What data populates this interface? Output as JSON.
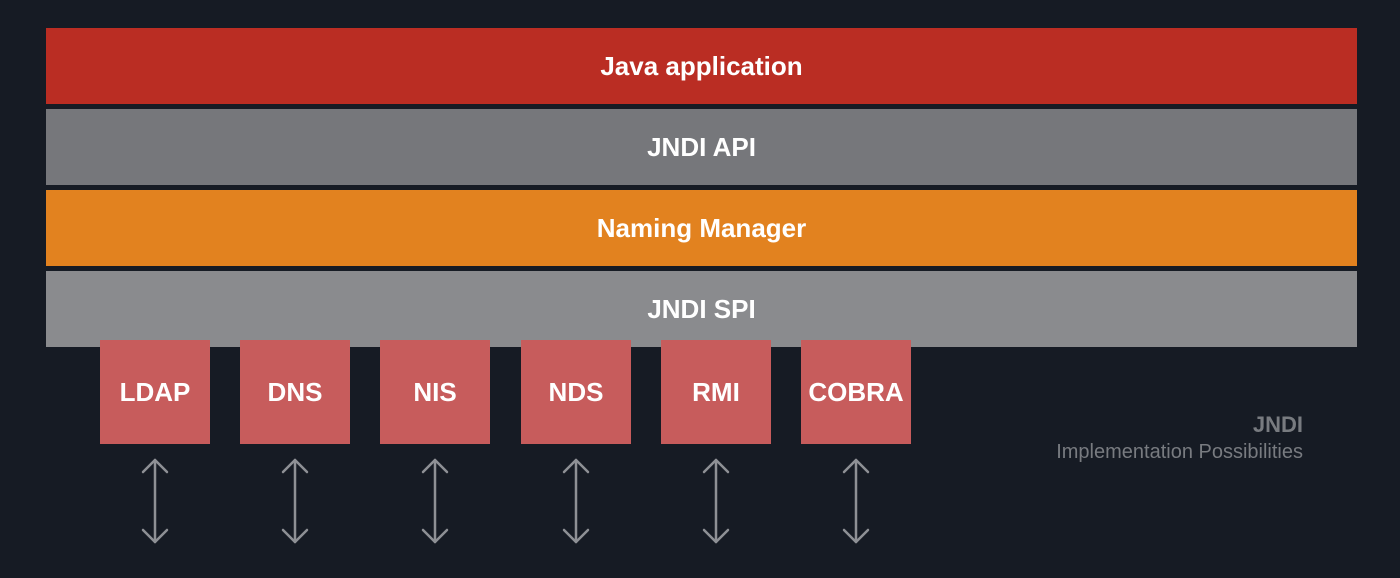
{
  "layers": [
    {
      "label": "Java application",
      "color": "#ba2d23"
    },
    {
      "label": "JNDI API",
      "color": "#76777b"
    },
    {
      "label": "Naming Manager",
      "color": "#e2821f"
    },
    {
      "label": "JNDI SPI",
      "color": "#8a8b8e"
    }
  ],
  "providers": {
    "color": "#c75c5c",
    "items": [
      {
        "label": "LDAP"
      },
      {
        "label": "DNS"
      },
      {
        "label": "NIS"
      },
      {
        "label": "NDS"
      },
      {
        "label": "RMI"
      },
      {
        "label": "COBRA"
      }
    ]
  },
  "arrow_icon": "double-arrow-vertical-icon",
  "arrow_color": "#8e9095",
  "caption": {
    "title": "JNDI",
    "subtitle": "Implementation Possibilities"
  },
  "background": "#161b24"
}
